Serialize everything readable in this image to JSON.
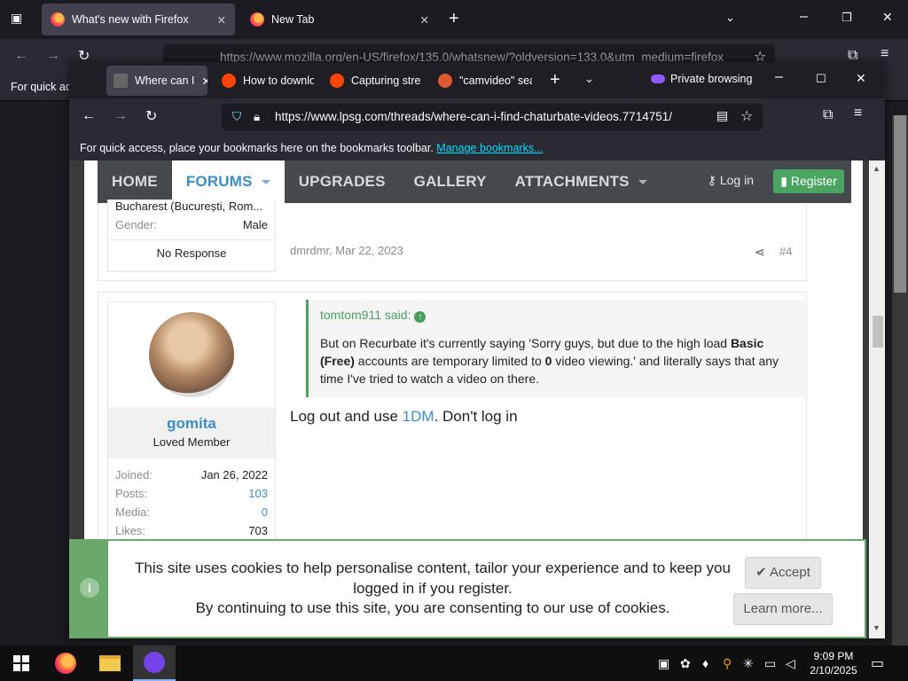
{
  "background_window": {
    "tabs": [
      {
        "label": "What's new with Firefox"
      },
      {
        "label": "New Tab"
      }
    ],
    "url": "https://www.mozilla.org/en-US/firefox/135.0/whatsnew/?oldversion=133.0&utm_medium=firefox",
    "bookmarks_bar": "For quick acc"
  },
  "private_window": {
    "tabs": [
      {
        "label": "Where can I"
      },
      {
        "label": "How to downlo"
      },
      {
        "label": "Capturing stre"
      },
      {
        "label": "\"camvideo\" sea"
      }
    ],
    "private_label": "Private browsing",
    "url": "https://www.lpsg.com/threads/where-can-i-find-chaturbate-videos.7714751/",
    "bookmarks_text": "For quick access, place your bookmarks here on the bookmarks toolbar.",
    "bookmarks_link": "Manage bookmarks..."
  },
  "site_nav": {
    "items": [
      {
        "label": "HOME"
      },
      {
        "label": "FORUMS"
      },
      {
        "label": "UPGRADES"
      },
      {
        "label": "GALLERY"
      },
      {
        "label": "ATTACHMENTS"
      }
    ],
    "login": "Log in",
    "register": "Register"
  },
  "post1": {
    "location": "Bucharest (București, Rom...",
    "gender_label": "Gender:",
    "gender_value": "Male",
    "response": "No Response",
    "meta": "dmrdmr, Mar 22, 2023",
    "number": "#4"
  },
  "post2": {
    "username": "gomita",
    "user_title": "Loved Member",
    "stats": [
      {
        "label": "Joined:",
        "value": "Jan 26, 2022"
      },
      {
        "label": "Posts:",
        "value": "103"
      },
      {
        "label": "Media:",
        "value": "0"
      },
      {
        "label": "Likes:",
        "value": "703"
      }
    ],
    "quote_author": "tomtom911 said:",
    "quote_text_a": "But on Recurbate it's currently saying 'Sorry guys, but due to the high load ",
    "quote_bold_a": "Basic (Free)",
    "quote_text_b": " accounts are temporary limited to ",
    "quote_bold_b": "0",
    "quote_text_c": " video viewing.' and literally says that any time I've tried to watch a video on there.",
    "reply_a": "Log out and use ",
    "reply_link": "1DM",
    "reply_b": ". Don't log in"
  },
  "cookie_banner": {
    "line1": "This site uses cookies to help personalise content, tailor your experience and to keep you logged in if you register.",
    "line2": "By continuing to use this site, you are consenting to our use of cookies.",
    "accept": "Accept",
    "learn_more": "Learn more..."
  },
  "taskbar": {
    "time": "9:09 PM",
    "date": "2/10/2025"
  },
  "colors": {
    "accent_blue": "#3a8fc7",
    "register_green": "#4aa462",
    "cookie_green": "#6aa96b",
    "nav_bg": "#44494d"
  }
}
